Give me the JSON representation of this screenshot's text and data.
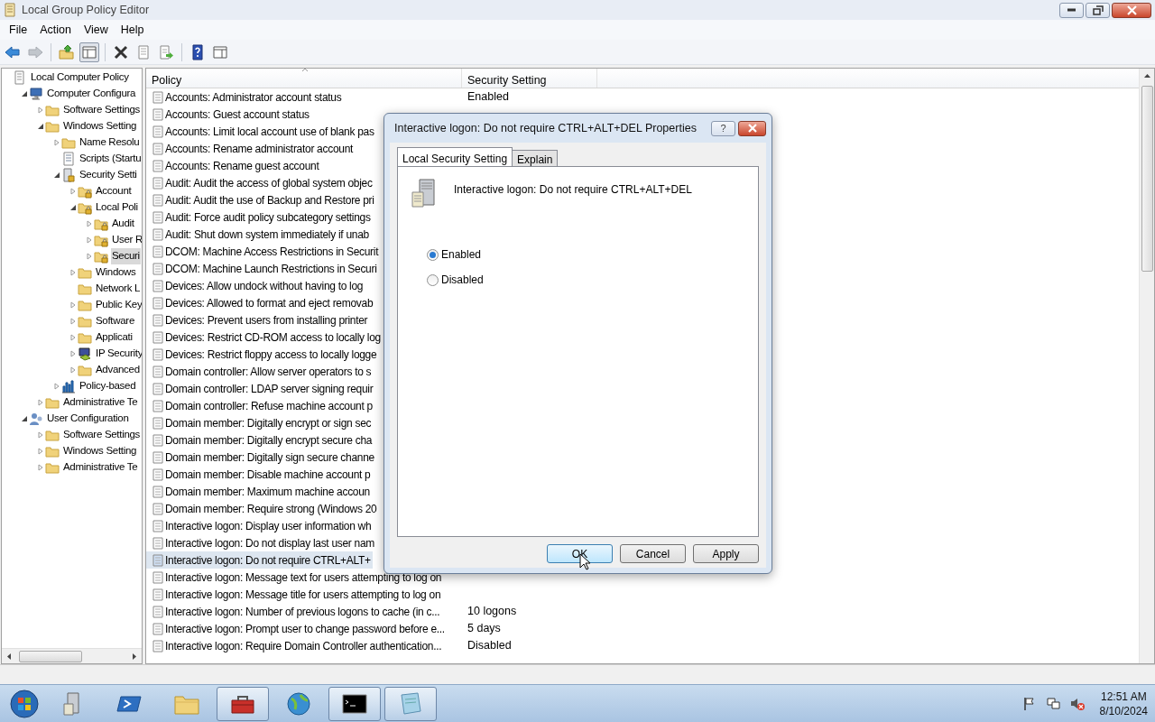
{
  "window": {
    "title": "Local Group Policy Editor"
  },
  "menu": [
    "File",
    "Action",
    "View",
    "Help"
  ],
  "toolbar": [
    {
      "kind": "back",
      "pressed": false,
      "disabled": false
    },
    {
      "kind": "forward",
      "pressed": false,
      "disabled": true
    },
    {
      "kind": "sep"
    },
    {
      "kind": "up",
      "pressed": false,
      "disabled": false
    },
    {
      "kind": "tree",
      "pressed": true,
      "disabled": false
    },
    {
      "kind": "sep"
    },
    {
      "kind": "delete",
      "pressed": false,
      "disabled": false
    },
    {
      "kind": "properties",
      "pressed": false,
      "disabled": false
    },
    {
      "kind": "export",
      "pressed": false,
      "disabled": false
    },
    {
      "kind": "sep"
    },
    {
      "kind": "help",
      "pressed": false,
      "disabled": false
    },
    {
      "kind": "pane",
      "pressed": false,
      "disabled": false
    }
  ],
  "tree": [
    {
      "label": "Local Computer Policy",
      "kind": "policy",
      "selected": false,
      "children": [
        {
          "label": "Computer Configura",
          "kind": "computer",
          "expanded": true,
          "selected": false,
          "children": [
            {
              "label": "Software Settings",
              "kind": "folder",
              "expanded": false,
              "selected": false
            },
            {
              "label": "Windows Setting",
              "kind": "folder",
              "expanded": true,
              "selected": false,
              "children": [
                {
                  "label": "Name Resolu",
                  "kind": "folder",
                  "expanded": false,
                  "selected": false
                },
                {
                  "label": "Scripts (Startu",
                  "kind": "scripts",
                  "selected": false
                },
                {
                  "label": "Security Setti",
                  "kind": "security",
                  "expanded": true,
                  "selected": false,
                  "children": [
                    {
                      "label": "Account",
                      "kind": "lockfolder",
                      "expanded": false,
                      "selected": false
                    },
                    {
                      "label": "Local Poli",
                      "kind": "lockfolder",
                      "expanded": true,
                      "selected": false,
                      "children": [
                        {
                          "label": "Audit",
                          "kind": "lockfolder",
                          "expanded": false,
                          "selected": false
                        },
                        {
                          "label": "User R",
                          "kind": "lockfolder",
                          "expanded": false,
                          "selected": false
                        },
                        {
                          "label": "Securi",
                          "kind": "lockfolder",
                          "expanded": false,
                          "selected": true
                        }
                      ]
                    },
                    {
                      "label": "Windows",
                      "kind": "folder",
                      "expanded": false,
                      "selected": false
                    },
                    {
                      "label": "Network L",
                      "kind": "folder",
                      "selected": false
                    },
                    {
                      "label": "Public Key",
                      "kind": "folder",
                      "expanded": false,
                      "selected": false
                    },
                    {
                      "label": "Software",
                      "kind": "folder",
                      "expanded": false,
                      "selected": false
                    },
                    {
                      "label": "Applicati",
                      "kind": "folder",
                      "expanded": false,
                      "selected": false
                    },
                    {
                      "label": "IP Security",
                      "kind": "ipsec",
                      "expanded": false,
                      "selected": false
                    },
                    {
                      "label": "Advanced",
                      "kind": "folder",
                      "expanded": false,
                      "selected": false
                    }
                  ]
                },
                {
                  "label": "Policy-based",
                  "kind": "chart",
                  "expanded": false,
                  "selected": false
                }
              ]
            },
            {
              "label": "Administrative Te",
              "kind": "folder",
              "expanded": false,
              "selected": false
            }
          ]
        },
        {
          "label": "User Configuration",
          "kind": "user",
          "expanded": true,
          "selected": false,
          "children": [
            {
              "label": "Software Settings",
              "kind": "folder",
              "expanded": false,
              "selected": false
            },
            {
              "label": "Windows Setting",
              "kind": "folder",
              "expanded": false,
              "selected": false
            },
            {
              "label": "Administrative Te",
              "kind": "folder",
              "expanded": false,
              "selected": false
            }
          ]
        }
      ]
    }
  ],
  "table": {
    "columns": [
      "Policy",
      "Security Setting"
    ],
    "rows": [
      {
        "policy": "Accounts: Administrator account status",
        "setting": "Enabled",
        "selected": false
      },
      {
        "policy": "Accounts: Guest account status",
        "selected": false
      },
      {
        "policy": "Accounts: Limit local account use of blank pas",
        "selected": false
      },
      {
        "policy": "Accounts: Rename administrator account",
        "selected": false
      },
      {
        "policy": "Accounts: Rename guest account",
        "selected": false
      },
      {
        "policy": "Audit: Audit the access of global system objec",
        "selected": false
      },
      {
        "policy": "Audit: Audit the use of Backup and Restore pri",
        "selected": false
      },
      {
        "policy": "Audit: Force audit policy subcategory settings",
        "selected": false
      },
      {
        "policy": "Audit: Shut down system immediately if unab",
        "selected": false
      },
      {
        "policy": "DCOM: Machine Access Restrictions in Securit",
        "selected": false
      },
      {
        "policy": "DCOM: Machine Launch Restrictions in Securi",
        "selected": false
      },
      {
        "policy": "Devices: Allow undock without having to log",
        "selected": false
      },
      {
        "policy": "Devices: Allowed to format and eject removab",
        "selected": false
      },
      {
        "policy": "Devices: Prevent users from installing printer",
        "selected": false
      },
      {
        "policy": "Devices: Restrict CD-ROM access to locally log",
        "selected": false
      },
      {
        "policy": "Devices: Restrict floppy access to locally logge",
        "selected": false
      },
      {
        "policy": "Domain controller: Allow server operators to s",
        "selected": false
      },
      {
        "policy": "Domain controller: LDAP server signing requir",
        "selected": false
      },
      {
        "policy": "Domain controller: Refuse machine account p",
        "selected": false
      },
      {
        "policy": "Domain member: Digitally encrypt or sign sec",
        "selected": false
      },
      {
        "policy": "Domain member: Digitally encrypt secure cha",
        "selected": false
      },
      {
        "policy": "Domain member: Digitally sign secure channe",
        "selected": false
      },
      {
        "policy": "Domain member: Disable machine account p",
        "selected": false
      },
      {
        "policy": "Domain member: Maximum machine accoun",
        "selected": false
      },
      {
        "policy": "Domain member: Require strong (Windows 20",
        "selected": false
      },
      {
        "policy": "Interactive logon: Display user information wh",
        "selected": false
      },
      {
        "policy": "Interactive logon: Do not display last user nam",
        "selected": false
      },
      {
        "policy": "Interactive logon: Do not require CTRL+ALT+",
        "selected": true
      },
      {
        "policy": "Interactive logon: Message text for users attempting to log on",
        "selected": false
      },
      {
        "policy": "Interactive logon: Message title for users attempting to log on",
        "selected": false
      },
      {
        "policy": "Interactive logon: Number of previous logons to cache (in c...",
        "setting": "10 logons",
        "selected": false
      },
      {
        "policy": "Interactive logon: Prompt user to change password before e...",
        "setting": "5 days",
        "selected": false
      },
      {
        "policy": "Interactive logon: Require Domain Controller authentication...",
        "setting": "Disabled",
        "selected": false
      }
    ]
  },
  "dialog": {
    "title": "Interactive logon: Do not require CTRL+ALT+DEL Properties",
    "help": "?",
    "tabs": [
      {
        "label": "Local Security Setting",
        "selected": true
      },
      {
        "label": "Explain",
        "selected": false
      }
    ],
    "policy_name": "Interactive logon: Do not require CTRL+ALT+DEL",
    "options": [
      {
        "label": "Enabled",
        "selected": true
      },
      {
        "label": "Disabled",
        "selected": false
      }
    ],
    "buttons": [
      {
        "label": "OK",
        "default": true
      },
      {
        "label": "Cancel",
        "default": false
      },
      {
        "label": "Apply",
        "default": false
      }
    ]
  },
  "taskbar": {
    "apps": [
      {
        "kind": "server",
        "running": false
      },
      {
        "kind": "shell",
        "running": false
      },
      {
        "kind": "explorer",
        "running": false
      },
      {
        "kind": "toolbox",
        "running": true
      },
      {
        "kind": "globe",
        "running": false
      },
      {
        "kind": "cmd",
        "running": true
      },
      {
        "kind": "notepad",
        "running": true
      }
    ],
    "tray": [
      {
        "kind": "flag"
      },
      {
        "kind": "network"
      },
      {
        "kind": "speaker-muted"
      }
    ],
    "time": "12:51 AM",
    "date": "8/10/2024"
  }
}
